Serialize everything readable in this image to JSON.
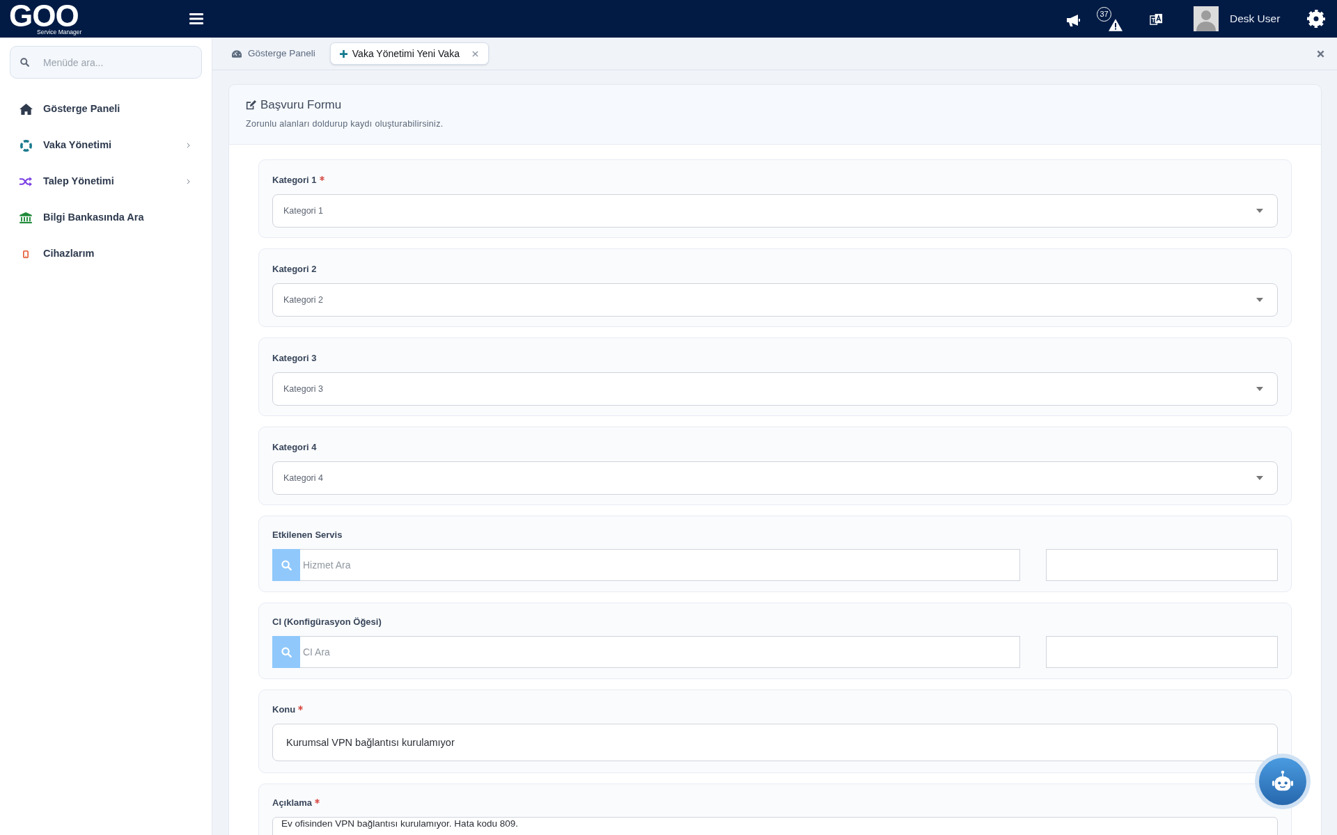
{
  "header": {
    "logo": {
      "wordmark": "GOO",
      "tagline": "Service Manager"
    },
    "alert_count": "37",
    "user": {
      "name": "Desk User"
    }
  },
  "sidebar": {
    "search": {
      "placeholder": "Menüde ara..."
    },
    "items": [
      {
        "label": "Gösterge Paneli",
        "kind": "home",
        "color": "#2f3a4d",
        "submenu": false
      },
      {
        "label": "Vaka Yönetimi",
        "kind": "lifebuoy",
        "color": "#1b7a8f",
        "submenu": true
      },
      {
        "label": "Talep Yönetimi",
        "kind": "shuffle",
        "color": "#7b3fe4",
        "submenu": true
      },
      {
        "label": "Bilgi Bankasında Ara",
        "kind": "bank",
        "color": "#1f8a3a",
        "submenu": false
      },
      {
        "label": "Cihazlarım",
        "kind": "phone",
        "color": "#e2542b",
        "submenu": false
      }
    ]
  },
  "tabs": [
    {
      "label": "Gösterge Paneli",
      "kind": "dashboard",
      "selected": false,
      "closable": false
    },
    {
      "label": "Vaka Yönetimi Yeni Vaka",
      "kind": "new",
      "selected": true,
      "closable": true
    }
  ],
  "form": {
    "title": "Başvuru Formu",
    "subtitle": "Zorunlu alanları doldurup kaydı oluşturabilirsiniz.",
    "fields": [
      {
        "kind": "select",
        "label": "Kategori 1",
        "required": true,
        "placeholder": "Kategori 1"
      },
      {
        "kind": "select",
        "label": "Kategori 2",
        "required": false,
        "placeholder": "Kategori 2"
      },
      {
        "kind": "select",
        "label": "Kategori 3",
        "required": false,
        "placeholder": "Kategori 3"
      },
      {
        "kind": "select",
        "label": "Kategori 4",
        "required": false,
        "placeholder": "Kategori 4"
      },
      {
        "kind": "lookup",
        "label": "Etkilenen Servis",
        "required": false,
        "placeholder": "Hizmet Ara"
      },
      {
        "kind": "lookup",
        "label": "CI (Konfigürasyon Öğesi)",
        "required": false,
        "placeholder": "CI Ara"
      },
      {
        "kind": "text",
        "label": "Konu",
        "required": true,
        "value": "Kurumsal VPN bağlantısı kurulamıyor"
      },
      {
        "kind": "textarea",
        "label": "Açıklama",
        "required": true,
        "value": "Ev ofisinden VPN bağlantısı kurulamıyor. Hata kodu 809."
      }
    ]
  }
}
